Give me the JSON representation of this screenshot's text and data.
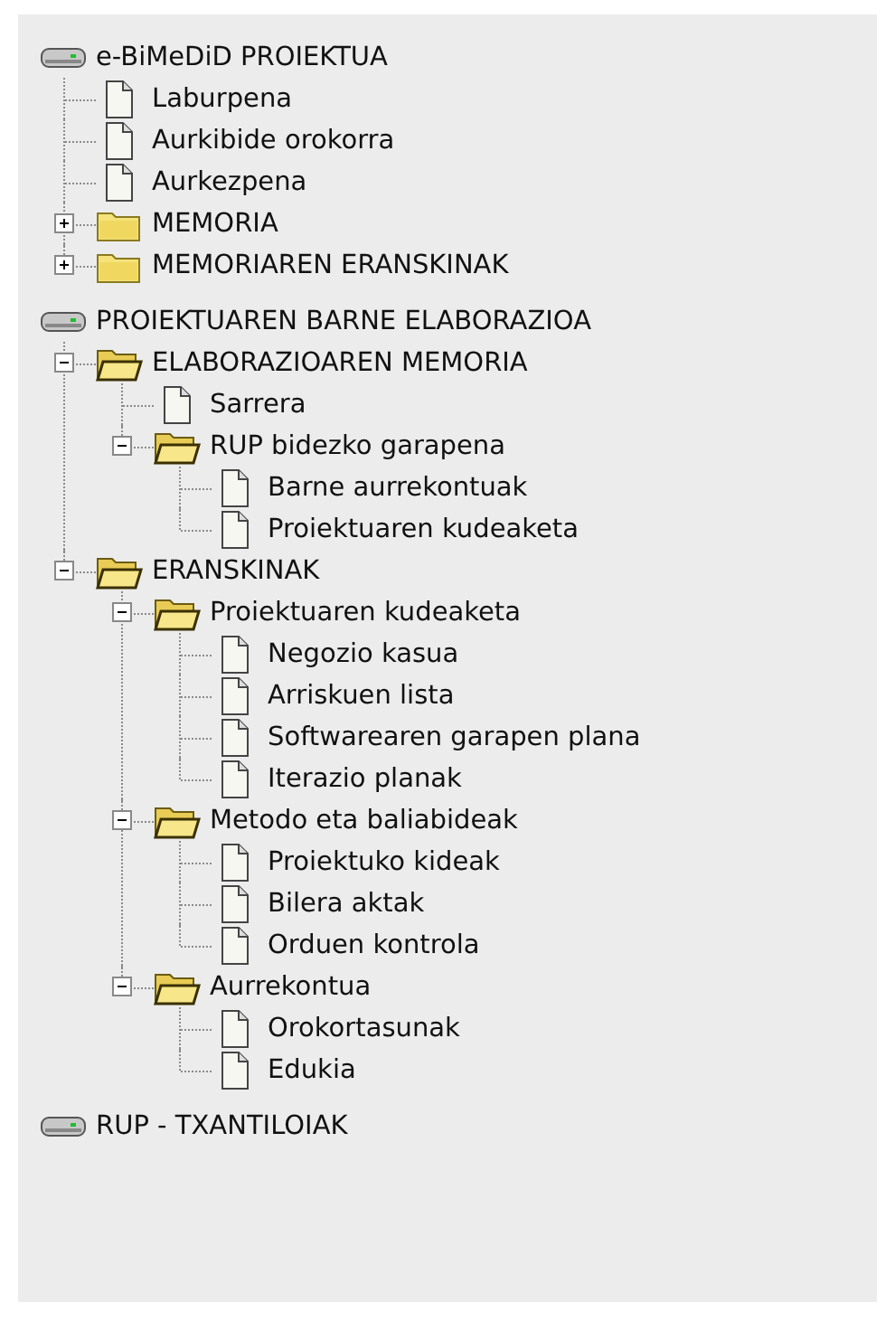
{
  "tree": [
    {
      "kind": "drive",
      "label": "e-BiMeDiD PROIEKTUA",
      "children": [
        {
          "kind": "file",
          "label": "Laburpena"
        },
        {
          "kind": "file",
          "label": "Aurkibide orokorra"
        },
        {
          "kind": "file",
          "label": "Aurkezpena"
        },
        {
          "kind": "folder",
          "label": "MEMORIA",
          "expanded": false
        },
        {
          "kind": "folder",
          "label": "MEMORIAREN ERANSKINAK",
          "expanded": false
        }
      ]
    },
    {
      "kind": "drive",
      "label": "PROIEKTUAREN BARNE ELABORAZIOA",
      "children": [
        {
          "kind": "folder",
          "label": "ELABORAZIOAREN MEMORIA",
          "expanded": true,
          "children": [
            {
              "kind": "file",
              "label": "Sarrera"
            },
            {
              "kind": "folder",
              "label": "RUP bidezko garapena",
              "expanded": true,
              "children": [
                {
                  "kind": "file",
                  "label": "Barne aurrekontuak"
                },
                {
                  "kind": "file",
                  "label": "Proiektuaren kudeaketa"
                }
              ]
            }
          ]
        },
        {
          "kind": "folder",
          "label": "ERANSKINAK",
          "expanded": true,
          "children": [
            {
              "kind": "folder",
              "label": "Proiektuaren kudeaketa",
              "expanded": true,
              "children": [
                {
                  "kind": "file",
                  "label": "Negozio kasua"
                },
                {
                  "kind": "file",
                  "label": "Arriskuen lista"
                },
                {
                  "kind": "file",
                  "label": "Softwarearen garapen plana"
                },
                {
                  "kind": "file",
                  "label": "Iterazio planak"
                }
              ]
            },
            {
              "kind": "folder",
              "label": "Metodo eta baliabideak",
              "expanded": true,
              "children": [
                {
                  "kind": "file",
                  "label": "Proiektuko kideak"
                },
                {
                  "kind": "file",
                  "label": "Bilera aktak"
                },
                {
                  "kind": "file",
                  "label": "Orduen kontrola"
                }
              ]
            },
            {
              "kind": "folder",
              "label": "Aurrekontua",
              "expanded": true,
              "children": [
                {
                  "kind": "file",
                  "label": "Orokortasunak"
                },
                {
                  "kind": "file",
                  "label": "Edukia"
                }
              ]
            }
          ]
        }
      ]
    },
    {
      "kind": "drive",
      "label": "RUP - TXANTILOIAK"
    }
  ]
}
